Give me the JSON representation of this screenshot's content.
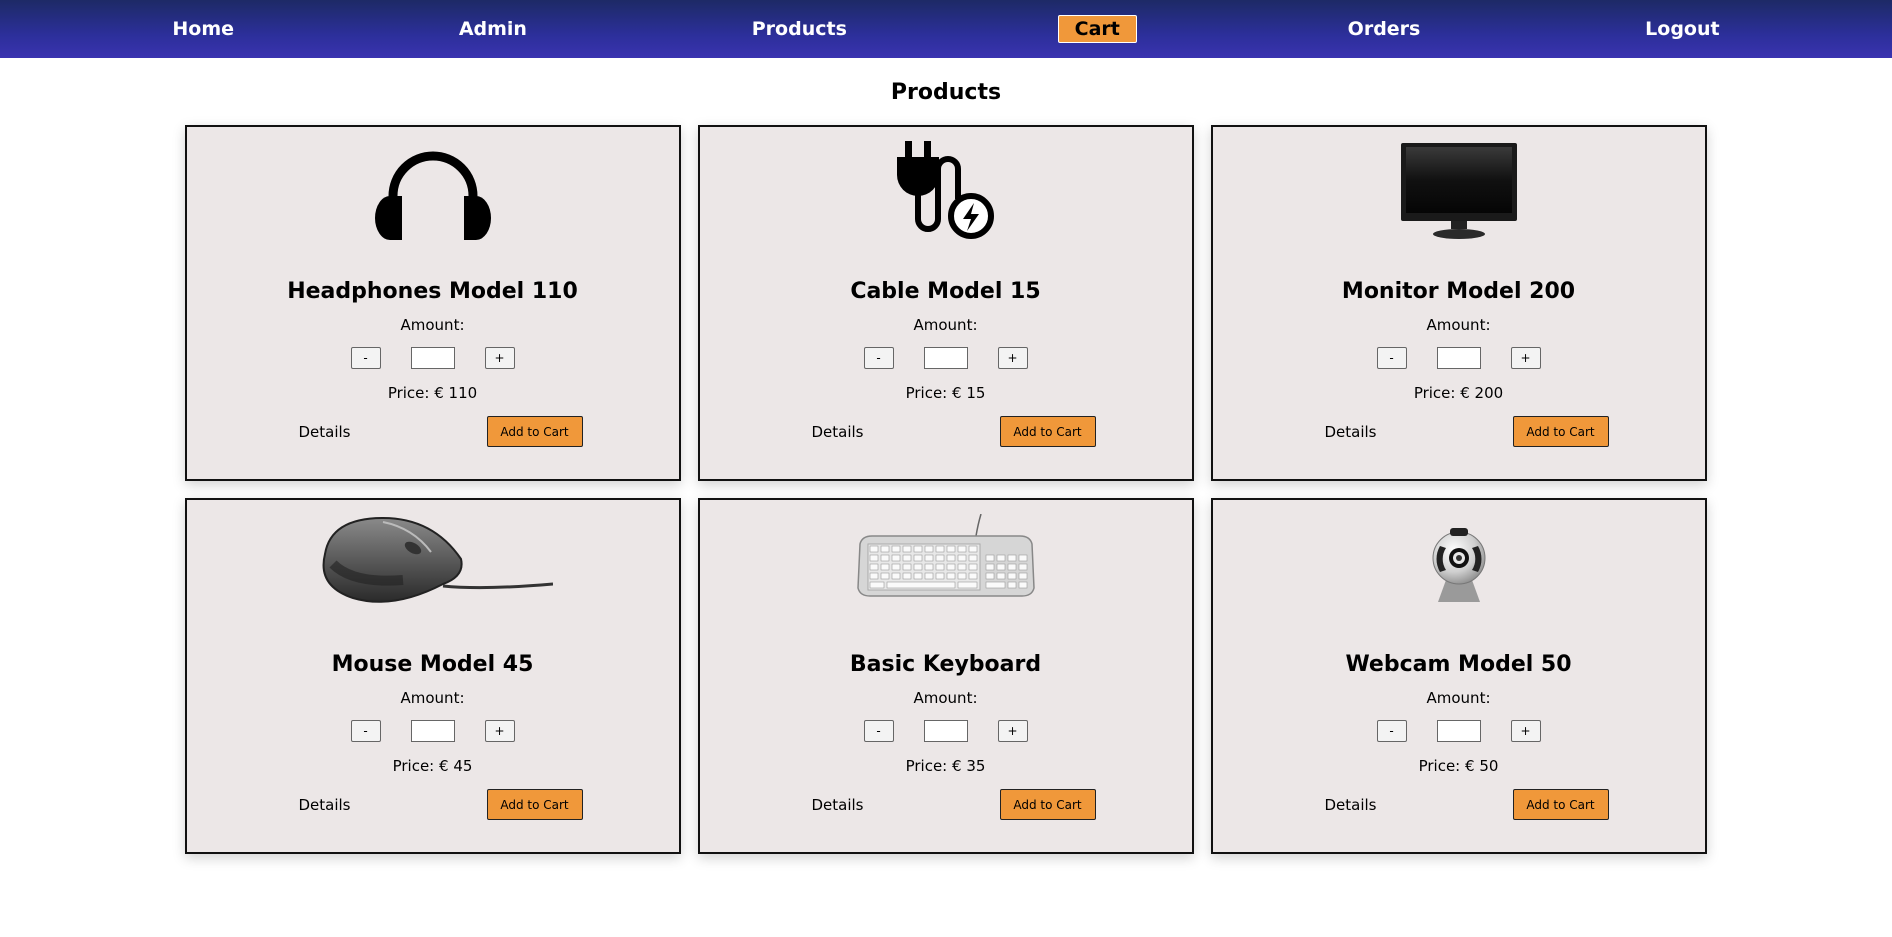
{
  "nav": {
    "items": [
      {
        "label": "Home",
        "active": false
      },
      {
        "label": "Admin",
        "active": false
      },
      {
        "label": "Products",
        "active": false
      },
      {
        "label": "Cart",
        "active": true
      },
      {
        "label": "Orders",
        "active": false
      },
      {
        "label": "Logout",
        "active": false
      }
    ],
    "active_color": "#f0983a"
  },
  "page": {
    "title": "Products"
  },
  "products": [
    {
      "name": "Headphones Model 110",
      "image": "headphones-icon",
      "amount_label": "Amount:",
      "minus": "-",
      "plus": "+",
      "quantity": "",
      "price": "Price: € 110",
      "details_label": "Details",
      "add_label": "Add to Cart"
    },
    {
      "name": "Cable Model 15",
      "image": "power-cable-icon",
      "amount_label": "Amount:",
      "minus": "-",
      "plus": "+",
      "quantity": "",
      "price": "Price: € 15",
      "details_label": "Details",
      "add_label": "Add to Cart"
    },
    {
      "name": "Monitor Model 200",
      "image": "monitor-image",
      "amount_label": "Amount:",
      "minus": "-",
      "plus": "+",
      "quantity": "",
      "price": "Price: € 200",
      "details_label": "Details",
      "add_label": "Add to Cart"
    },
    {
      "name": "Mouse Model 45",
      "image": "mouse-image",
      "amount_label": "Amount:",
      "minus": "-",
      "plus": "+",
      "quantity": "",
      "price": "Price: € 45",
      "details_label": "Details",
      "add_label": "Add to Cart"
    },
    {
      "name": "Basic Keyboard",
      "image": "keyboard-image",
      "amount_label": "Amount:",
      "minus": "-",
      "plus": "+",
      "quantity": "",
      "price": "Price: € 35",
      "details_label": "Details",
      "add_label": "Add to Cart"
    },
    {
      "name": "Webcam Model 50",
      "image": "webcam-image",
      "amount_label": "Amount:",
      "minus": "-",
      "plus": "+",
      "quantity": "",
      "price": "Price: € 50",
      "details_label": "Details",
      "add_label": "Add to Cart"
    }
  ]
}
